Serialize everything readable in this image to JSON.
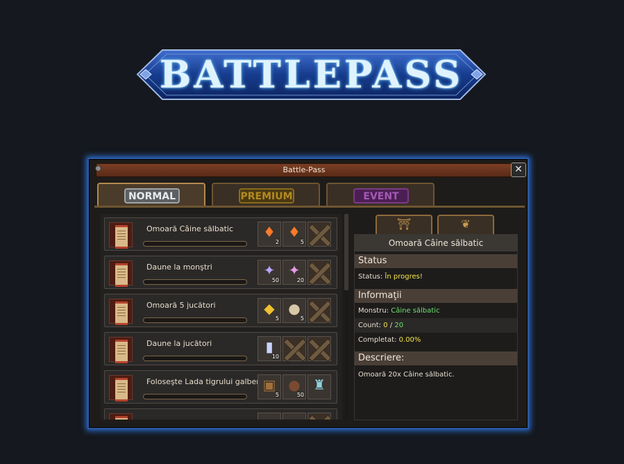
{
  "banner": {
    "title": "BATTLEPASS"
  },
  "window": {
    "title": "Battle-Pass",
    "close_icon": "close-icon",
    "tabs": [
      {
        "label": "NORMAL",
        "active": true
      },
      {
        "label": "PREMIUM",
        "active": false
      },
      {
        "label": "EVENT",
        "active": false
      }
    ]
  },
  "quests": [
    {
      "name": "Omoară Câine sălbatic",
      "progress": 0,
      "rewards": [
        {
          "icon": "red-crystal-icon",
          "count": "2"
        },
        {
          "icon": "red-crystal-icon",
          "count": "5"
        },
        {
          "icon": "locked-slot",
          "count": ""
        }
      ]
    },
    {
      "name": "Daune la monştri",
      "progress": 0,
      "rewards": [
        {
          "icon": "blue-crystal-icon",
          "count": "50"
        },
        {
          "icon": "pink-crystal-icon",
          "count": "20"
        },
        {
          "icon": "locked-slot",
          "count": ""
        }
      ]
    },
    {
      "name": "Omoară 5 jucători",
      "progress": 0,
      "rewards": [
        {
          "icon": "gold-ore-icon",
          "count": "5"
        },
        {
          "icon": "stone-ore-icon",
          "count": "5"
        },
        {
          "icon": "locked-slot",
          "count": ""
        }
      ]
    },
    {
      "name": "Daune la jucători",
      "progress": 0,
      "rewards": [
        {
          "icon": "potion-bottle-icon",
          "count": "10"
        },
        {
          "icon": "locked-slot",
          "count": ""
        },
        {
          "icon": "locked-slot",
          "count": ""
        }
      ]
    },
    {
      "name": "Foloseşte Lada tigrului galben",
      "progress": 0,
      "rewards": [
        {
          "icon": "treasure-chest-icon",
          "count": "5"
        },
        {
          "icon": "leather-bag-icon",
          "count": "50"
        },
        {
          "icon": "horned-helmet-icon",
          "count": ""
        }
      ]
    }
  ],
  "detail": {
    "heading": "Omoară Câine sălbatic",
    "status_title": "Status",
    "status_label": "Status:",
    "status_value": "În progres!",
    "info_title": "Informaţii",
    "monster_label": "Monstru:",
    "monster_value": "Câine sălbatic",
    "count_label": "Count:",
    "count_current": "0",
    "count_sep": "/",
    "count_total": "20",
    "completed_label": "Completat:",
    "completed_value": "0.00%",
    "desc_title": "Descriere:",
    "desc_text": "Omoară 20x Câine sălbatic."
  },
  "colors": {
    "window_border": "#2c5aa3",
    "highlight_yellow": "#f2e34b",
    "highlight_green": "#6fe06f"
  }
}
